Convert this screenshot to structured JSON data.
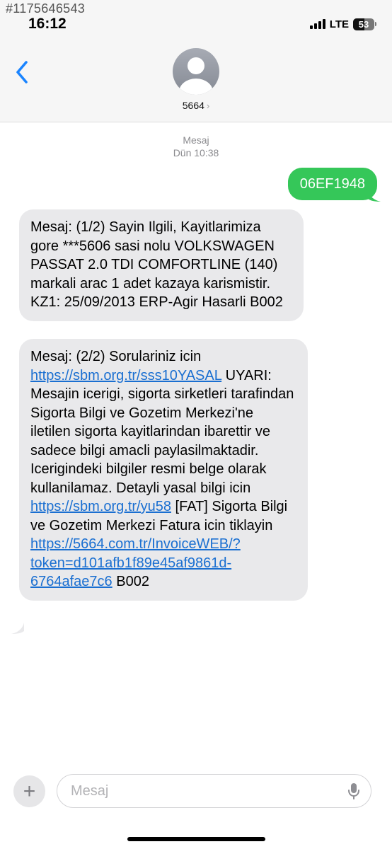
{
  "watermark": "#1175646543",
  "status_bar": {
    "time": "16:12",
    "network": "LTE",
    "battery_percent": 53,
    "battery_label": "53"
  },
  "header": {
    "back_icon": "chevron-left-icon",
    "avatar_icon": "person-silhouette-icon",
    "contact_name": "5664",
    "contact_chevron": "›"
  },
  "conversation": {
    "timestamp_label": "Mesaj",
    "timestamp_time": "Dün 10:38",
    "outgoing_message": "06EF1948",
    "message1": "Mesaj: (1/2) Sayin Ilgili, Kayitlarimiza gore ***5606 sasi nolu VOLKSWAGEN PASSAT 2.0 TDI COMFORTLINE (140) markali arac 1 adet kazaya karismistir. KZ1: 25/09/2013 ERP-Agir Hasarli B002",
    "message2": {
      "part1": "Mesaj: (2/2) Sorulariniz icin ",
      "link1": "https://sbm.org.tr/sss10YASAL",
      "part2": " UYARI: Mesajin icerigi, sigorta sirketleri tarafindan Sigorta Bilgi ve Gozetim Merkezi'ne iletilen sigorta kayitlarindan ibarettir ve sadece bilgi amacli paylasilmaktadir. Icerigindeki bilgiler resmi belge olarak kullanilamaz. Detayli yasal bilgi icin ",
      "link2": "https://sbm.org.tr/yu58",
      "part3": " [FAT] Sigorta Bilgi ve Gozetim Merkezi Fatura icin tiklayin ",
      "link3": "https://5664.com.tr/InvoiceWEB/?token=d101afb1f89e45af9861d-6764afae7c6",
      "part4": " B002"
    }
  },
  "input_bar": {
    "plus_label": "+",
    "placeholder": "Mesaj",
    "mic_icon": "microphone-icon"
  },
  "colors": {
    "outgoing_bubble": "#35c759",
    "incoming_bubble": "#e9e9eb",
    "link": "#1a6fd1",
    "accent": "#1a84ff"
  }
}
